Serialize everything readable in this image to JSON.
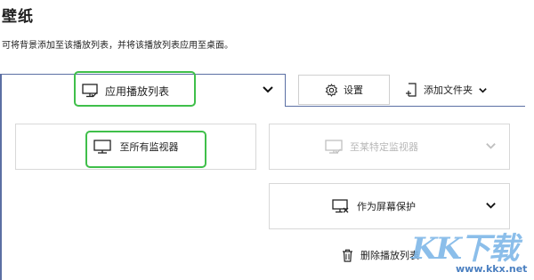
{
  "header": {
    "title": "壁纸",
    "description": "可将背景添加至该播放列表，并将该播放列表应用至桌面。"
  },
  "toolbar": {
    "apply_playlist_label": "应用播放列表",
    "settings_label": "设置",
    "add_folder_label": "添加文件夹"
  },
  "monitors": {
    "all_label": "至所有监视器",
    "specific_label": "至某特定监视器",
    "screensaver_label": "作为屏幕保护",
    "delete_playlist_label": "删除播放列表"
  },
  "watermark": {
    "logo": "KK下载",
    "url": "www.kkx.net"
  },
  "colors": {
    "highlight": "#3fbf4a",
    "panel_border": "#5b6fa3",
    "disabled_text": "#b8b8b8"
  }
}
